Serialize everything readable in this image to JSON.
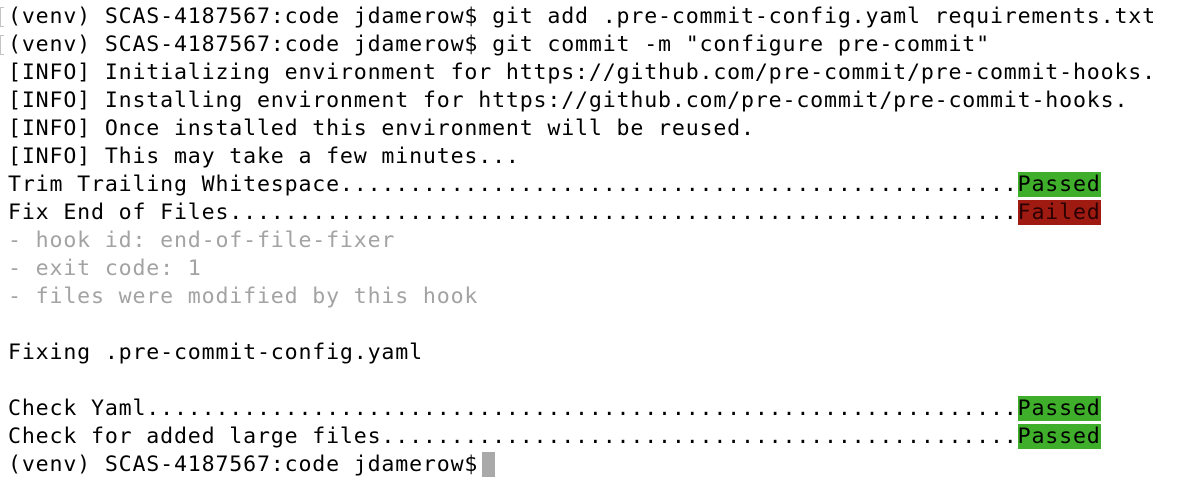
{
  "terminal": {
    "cmd1": "(venv) SCAS-4187567:code jdamerow$ git add .pre-commit-config.yaml requirements.txt",
    "cmd2": "(venv) SCAS-4187567:code jdamerow$ git commit -m \"configure pre-commit\"",
    "info1": "[INFO] Initializing environment for https://github.com/pre-commit/pre-commit-hooks.",
    "info2": "[INFO] Installing environment for https://github.com/pre-commit/pre-commit-hooks.",
    "info3": "[INFO] Once installed this environment will be reused.",
    "info4": "[INFO] This may take a few minutes...",
    "hook1_name": "Trim Trailing Whitespace.................................................",
    "hook1_status": "Passed",
    "hook2_name": "Fix End of Files.........................................................",
    "hook2_status": "Failed",
    "detail1": "- hook id: end-of-file-fixer",
    "detail2": "- exit code: 1",
    "detail3": "- files were modified by this hook",
    "fixing": "Fixing .pre-commit-config.yaml",
    "hook3_name": "Check Yaml...............................................................",
    "hook3_status": "Passed",
    "hook4_name": "Check for added large files..............................................",
    "hook4_status": "Passed",
    "prompt": "(venv) SCAS-4187567:code jdamerow$"
  }
}
